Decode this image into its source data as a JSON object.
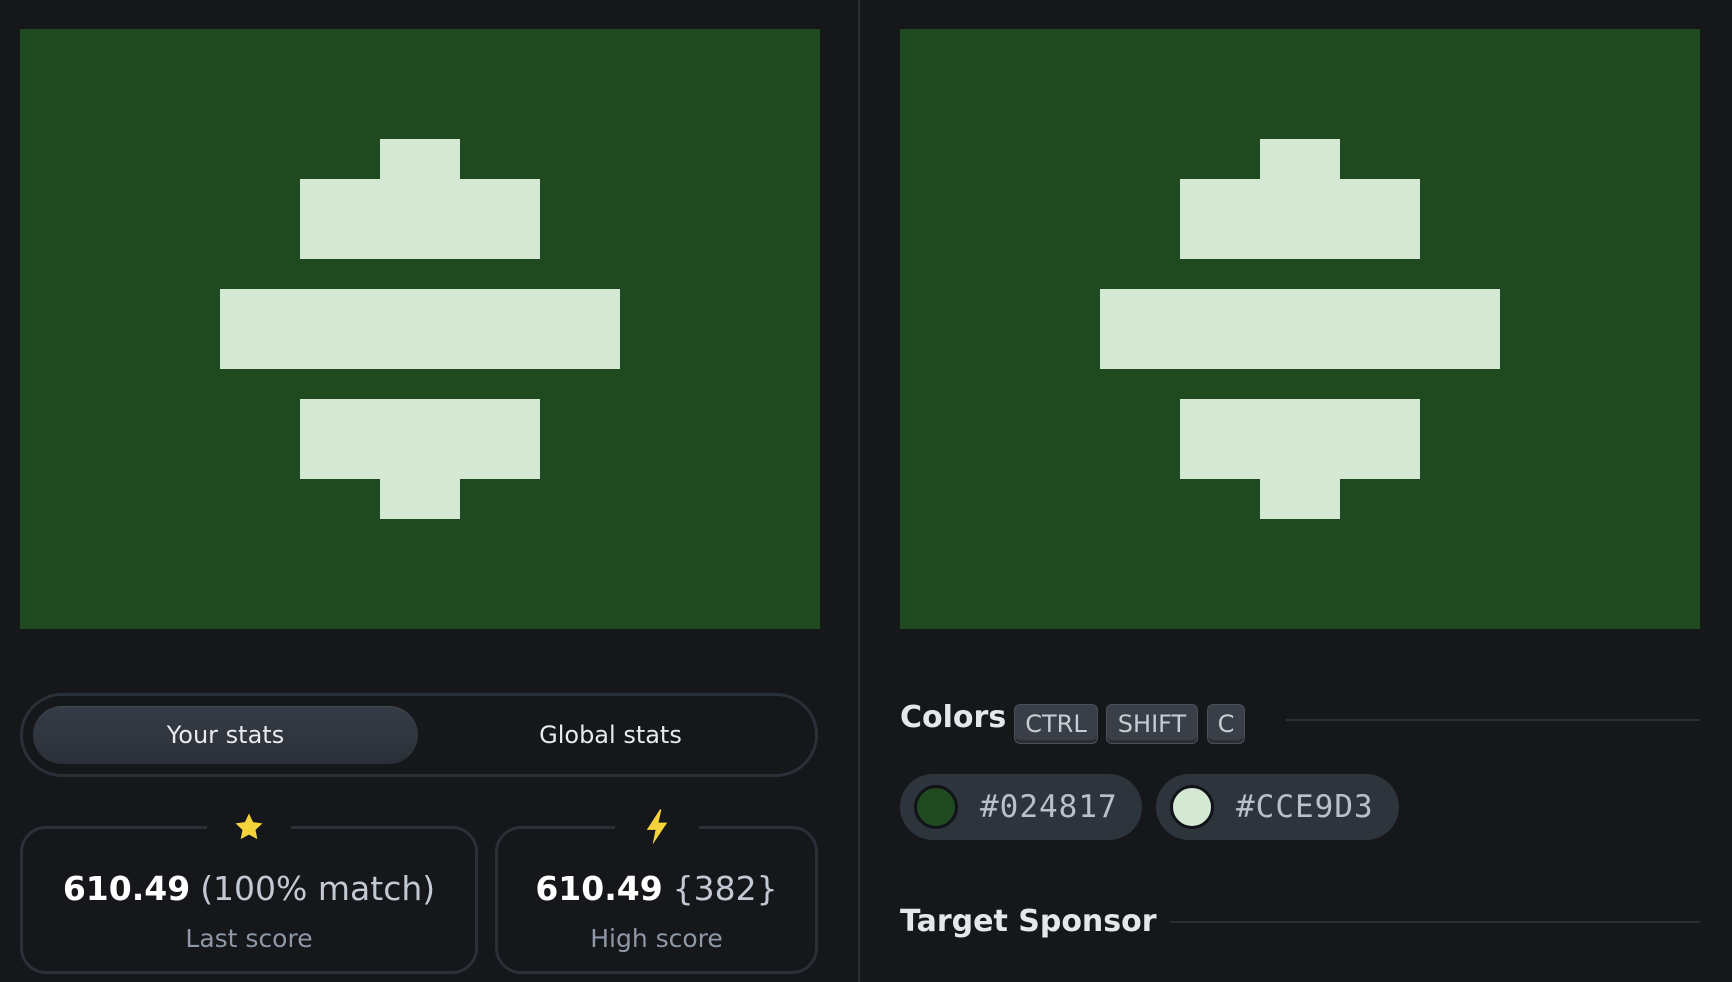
{
  "colors": {
    "background": "#024817",
    "foreground": "#CCE9D3"
  },
  "stats_toggle": {
    "your_stats_label": "Your stats",
    "global_stats_label": "Global stats",
    "active": "your_stats"
  },
  "last_score": {
    "value": "610.49",
    "extra": "(100% match)",
    "caption": "Last score",
    "icon": "star-icon"
  },
  "high_score": {
    "value": "610.49",
    "extra": "{382}",
    "caption": "High score",
    "icon": "lightning-icon"
  },
  "colors_section": {
    "title": "Colors",
    "shortcut_keys": [
      "CTRL",
      "SHIFT",
      "C"
    ],
    "swatches": [
      {
        "hex": "#024817",
        "display": "#024817"
      },
      {
        "hex": "#CCE9D3",
        "display": "#CCE9D3"
      }
    ]
  },
  "sponsor_section": {
    "title": "Target Sponsor"
  }
}
